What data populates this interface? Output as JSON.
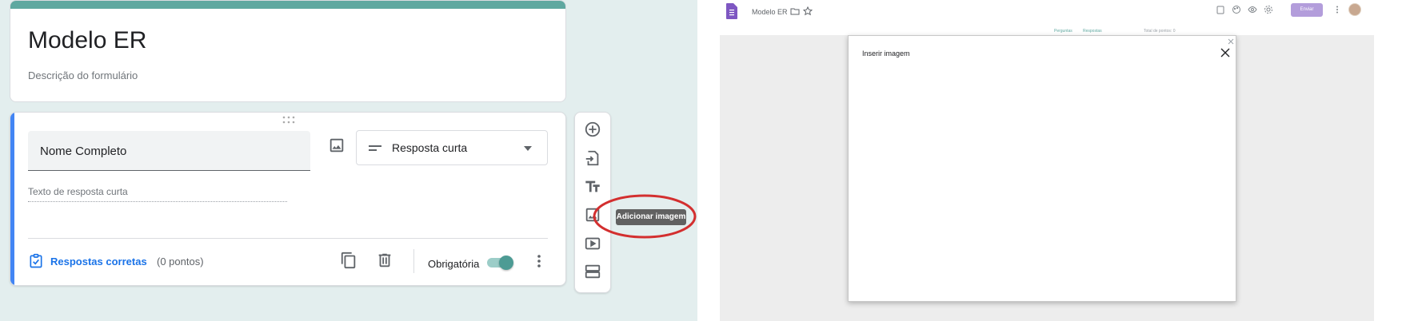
{
  "form": {
    "title": "Modelo ER",
    "description": "Descrição do formulário"
  },
  "question": {
    "title": "Nome Completo",
    "type": "Resposta curta",
    "placeholder": "Texto de resposta curta",
    "answer_key_label": "Respostas corretas",
    "points": "(0 pontos)",
    "required_label": "Obrigatória",
    "required": true
  },
  "toolbar": {
    "items": [
      "add-question",
      "import-questions",
      "add-title",
      "add-image",
      "add-video",
      "add-section"
    ],
    "tooltip": "Adicionar imagem"
  },
  "dialog_screenshot": {
    "doc_title": "Modelo ER",
    "send_label": "Enviar",
    "tabs": [
      "Perguntas",
      "Respostas"
    ],
    "total_points": "Total de pontos: 0",
    "dialog_title": "Inserir imagem"
  },
  "colors": {
    "theme": "#5fa8a0",
    "accent_blue": "#1a73e8",
    "highlight_ring": "#d32f2f",
    "send_button": "#b39ddb"
  }
}
